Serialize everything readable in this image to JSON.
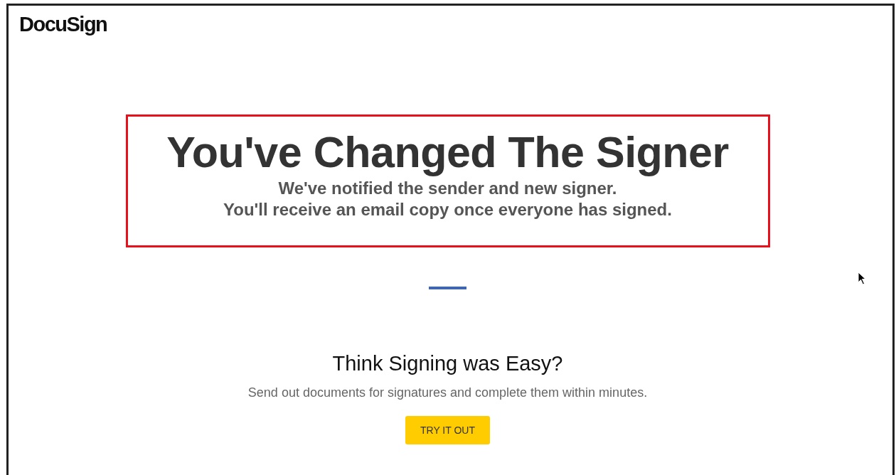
{
  "logo": "DocuSign",
  "highlight": {
    "title": "You've Changed The Signer",
    "lines": [
      "We've notified the sender and new signer.",
      "You'll receive an email copy once everyone has signed."
    ]
  },
  "promo": {
    "heading": "Think Signing was Easy?",
    "text": "Send out documents for signatures and complete them within minutes.",
    "button": "TRY IT OUT"
  }
}
